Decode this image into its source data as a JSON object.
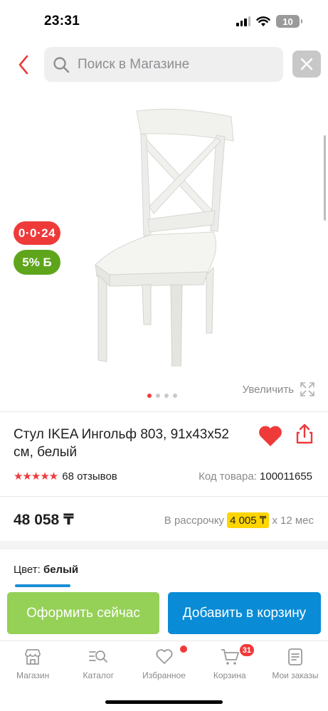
{
  "status_bar": {
    "time": "23:31",
    "battery": "10"
  },
  "search": {
    "placeholder": "Поиск в Магазине"
  },
  "gallery": {
    "badge_timer": "0·0·24",
    "badge_bonus": "5% Б",
    "zoom_label": "Увеличить",
    "slide_count": 4,
    "active_slide": 1
  },
  "product": {
    "title": "Стул IKEA Ингольф 803, 91x43x52 см, белый",
    "rating_stars": "★★★★★",
    "reviews": "68 отзывов",
    "sku_label": "Код товара:",
    "sku": "100011655",
    "price": "48 058 ₸",
    "installment_prefix": "В рассрочку",
    "installment_amount": "4 005 ₸",
    "installment_suffix": "x 12 мес",
    "color_label": "Цвет:",
    "color_value": "белый"
  },
  "actions": {
    "buy_now": "Оформить сейчас",
    "add_to_cart": "Добавить в корзину"
  },
  "tabbar": {
    "items": [
      {
        "label": "Магазин",
        "icon": "store-icon"
      },
      {
        "label": "Каталог",
        "icon": "catalog-search-icon"
      },
      {
        "label": "Избранное",
        "icon": "heart-icon"
      },
      {
        "label": "Корзина",
        "icon": "cart-icon",
        "badge": "31"
      },
      {
        "label": "Мои заказы",
        "icon": "orders-icon"
      }
    ]
  },
  "colors": {
    "accent_red": "#ef3a3a",
    "buy_now": "#95d057",
    "add_to_cart": "#0a8bd6",
    "installment_highlight": "#ffd500",
    "bonus_green": "#5ea51c"
  }
}
